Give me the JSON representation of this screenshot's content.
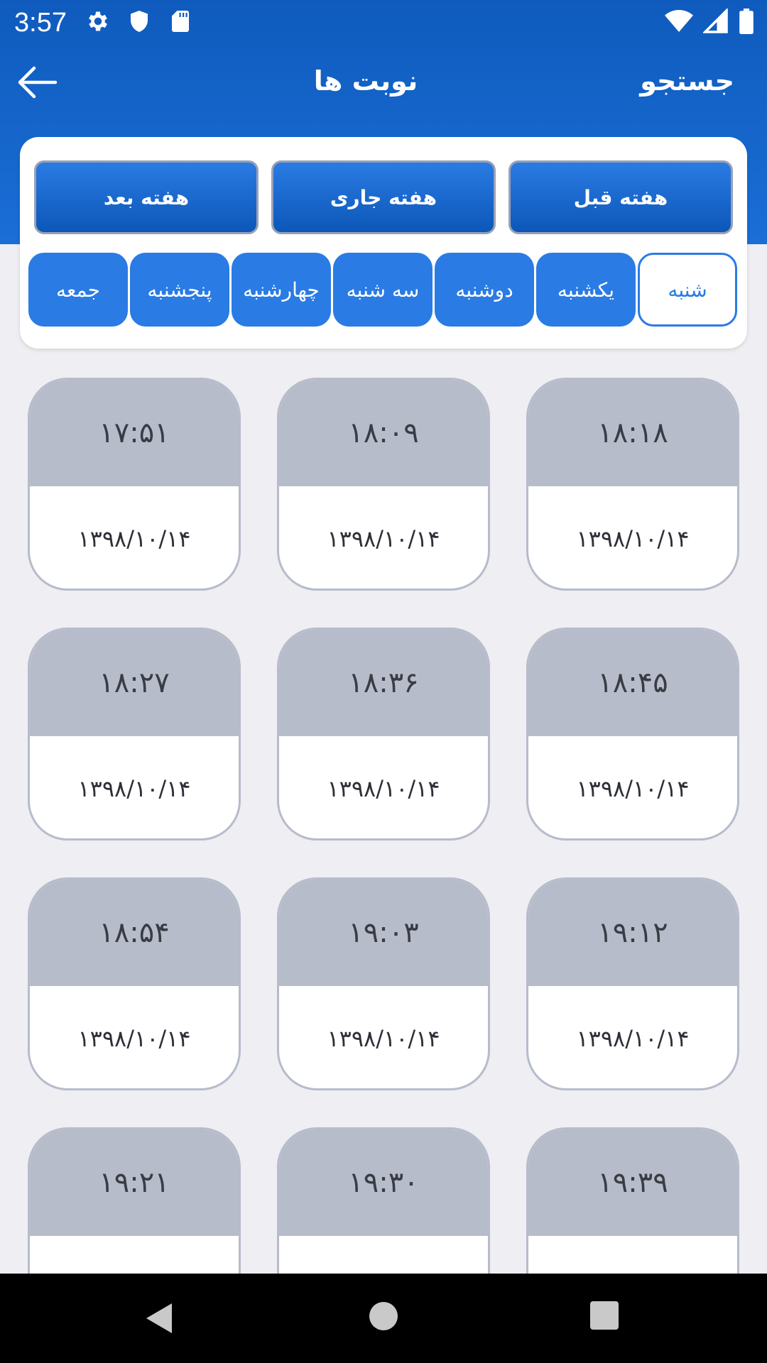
{
  "status_bar": {
    "time": "3:57",
    "left_icons": [
      "gear-icon",
      "shield-icon",
      "sd-card-icon"
    ],
    "right_icons": [
      "wifi-icon",
      "cell-signal-icon",
      "battery-icon"
    ]
  },
  "app_bar": {
    "title": "نوبت ها",
    "search_label": "جستجو",
    "back_icon": "arrow-left-icon"
  },
  "week_nav": {
    "previous": "هفته قبل",
    "current": "هفته جاری",
    "next": "هفته بعد"
  },
  "days": [
    {
      "label": "شنبه",
      "selected": true
    },
    {
      "label": "یکشنبه",
      "selected": false
    },
    {
      "label": "دوشنبه",
      "selected": false
    },
    {
      "label": "سه شنبه",
      "selected": false
    },
    {
      "label": "چهارشنبه",
      "selected": false
    },
    {
      "label": "پنجشنبه",
      "selected": false
    },
    {
      "label": "جمعه",
      "selected": false
    }
  ],
  "slots": [
    {
      "time": "۱۸:۱۸",
      "date": "۱۳۹۸/۱۰/۱۴"
    },
    {
      "time": "۱۸:۰۹",
      "date": "۱۳۹۸/۱۰/۱۴"
    },
    {
      "time": "۱۷:۵۱",
      "date": "۱۳۹۸/۱۰/۱۴"
    },
    {
      "time": "۱۸:۴۵",
      "date": "۱۳۹۸/۱۰/۱۴"
    },
    {
      "time": "۱۸:۳۶",
      "date": "۱۳۹۸/۱۰/۱۴"
    },
    {
      "time": "۱۸:۲۷",
      "date": "۱۳۹۸/۱۰/۱۴"
    },
    {
      "time": "۱۹:۱۲",
      "date": "۱۳۹۸/۱۰/۱۴"
    },
    {
      "time": "۱۹:۰۳",
      "date": "۱۳۹۸/۱۰/۱۴"
    },
    {
      "time": "۱۸:۵۴",
      "date": "۱۳۹۸/۱۰/۱۴"
    },
    {
      "time": "۱۹:۳۹",
      "date": ""
    },
    {
      "time": "۱۹:۳۰",
      "date": ""
    },
    {
      "time": "۱۹:۲۱",
      "date": ""
    }
  ],
  "colors": {
    "primary": "#1a6ed6",
    "primary_dark": "#0c57b8",
    "slot_header": "#b7bccb",
    "background": "#eeeef3"
  }
}
